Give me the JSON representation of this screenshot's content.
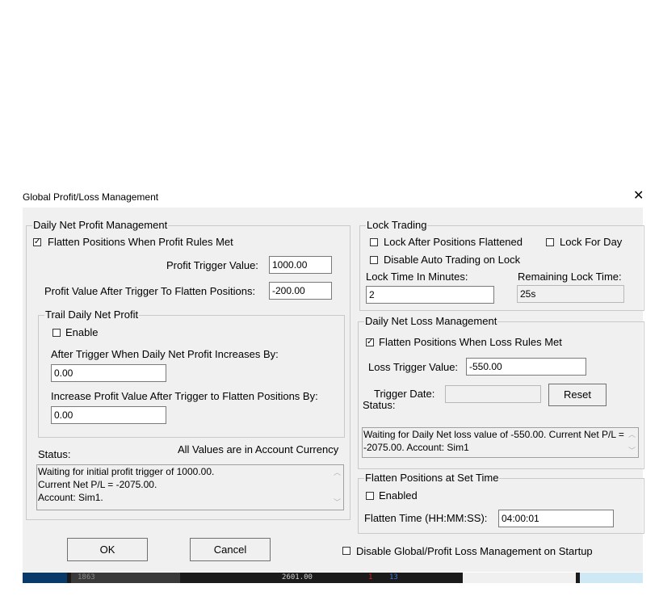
{
  "window": {
    "title": "Global Profit/Loss Management"
  },
  "profit": {
    "legend": "Daily Net Profit Management",
    "flatten_label": "Flatten Positions When Profit Rules Met",
    "flatten_checked": true,
    "trigger_label": "Profit Trigger Value:",
    "trigger_value": "1000.00",
    "after_label": "Profit Value After Trigger To Flatten Positions:",
    "after_value": "-200.00",
    "trail": {
      "legend": "Trail Daily Net Profit",
      "enable_label": "Enable",
      "enable_checked": false,
      "increase_label": "After Trigger When Daily Net Profit Increases By:",
      "increase_value": "0.00",
      "inc_flatten_label": "Increase Profit Value After Trigger to Flatten Positions By:",
      "inc_flatten_value": "0.00"
    },
    "status_label": "Status:",
    "currency_note": "All Values are in Account Currency",
    "status_text": "Waiting for initial profit trigger of 1000.00.\nCurrent Net P/L = -2075.00.\nAccount: Sim1."
  },
  "lock": {
    "legend": "Lock Trading",
    "after_flat_label": "Lock After Positions Flattened",
    "after_flat_checked": false,
    "for_day_label": "Lock For Day",
    "for_day_checked": false,
    "disable_auto_label": "Disable Auto Trading on Lock",
    "disable_auto_checked": false,
    "minutes_label": "Lock Time In Minutes:",
    "minutes_value": "2",
    "remaining_label": "Remaining Lock Time:",
    "remaining_value": "25s"
  },
  "loss": {
    "legend": "Daily Net Loss Management",
    "flatten_label": "Flatten Positions When Loss Rules Met",
    "flatten_checked": true,
    "trigger_label": "Loss Trigger Value:",
    "trigger_value": "-550.00",
    "date_label": "Trigger Date:",
    "date_value": "",
    "reset_label": "Reset",
    "status_label": "Status:",
    "status_text": "Waiting for Daily Net loss value of -550.00.  Current Net P/L = -2075.00.  Account: Sim1"
  },
  "flatten_time": {
    "legend": "Flatten Positions at Set Time",
    "enabled_label": "Enabled",
    "enabled_checked": false,
    "time_label": "Flatten Time (HH:MM:SS):",
    "time_value": "04:00:01"
  },
  "footer": {
    "ok_label": "OK",
    "cancel_label": "Cancel",
    "disable_startup_label": "Disable Global/Profit Loss Management on Startup",
    "disable_startup_checked": false
  },
  "taskbar": {
    "a": "1863",
    "b": "2601.00",
    "c": "1",
    "d": "13"
  },
  "colors": {
    "dialog_bg": "#f0f0f0",
    "border": "#c9c9c9",
    "taskbar_bg": "#1b1b1b",
    "red": "#e02020",
    "blue": "#3a7be0"
  }
}
